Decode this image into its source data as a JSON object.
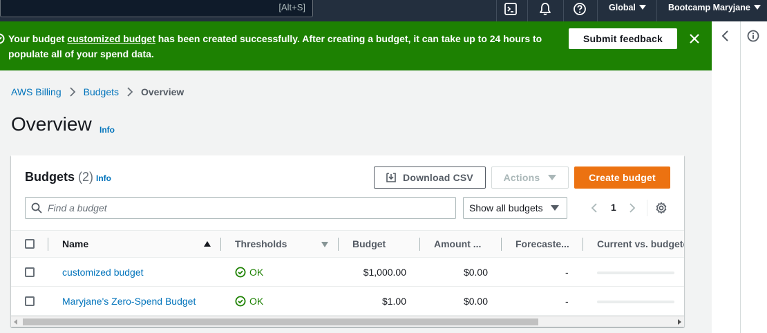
{
  "topnav": {
    "search_shortcut": "[Alt+S]",
    "region": "Global",
    "account": "Bootcamp Maryjane",
    "icons": [
      "cloudshell-icon",
      "bell-icon",
      "help-icon"
    ]
  },
  "flash": {
    "prefix": "Your budget ",
    "link": "customized budget",
    "suffix": " has been created successfully. After creating a budget, it can take up to 24 hours to populate all of your spend data.",
    "feedback_label": "Submit feedback"
  },
  "breadcrumb": {
    "items": [
      "AWS Billing",
      "Budgets"
    ],
    "current": "Overview"
  },
  "page": {
    "title": "Overview",
    "info": "Info"
  },
  "budgets": {
    "title": "Budgets",
    "count": "(2)",
    "info": "Info",
    "download_label": "Download CSV",
    "actions_label": "Actions",
    "create_label": "Create budget",
    "search_placeholder": "Find a budget",
    "filter_value": "Show all budgets",
    "page_number": "1",
    "columns": [
      "Name",
      "Thresholds",
      "Budget",
      "Amount ...",
      "Forecaste...",
      "Current vs. budgeted"
    ],
    "rows": [
      {
        "name": "customized budget",
        "threshold": "OK",
        "budget": "$1,000.00",
        "amount": "$0.00",
        "forecast": "-"
      },
      {
        "name": "Maryjane's Zero-Spend Budget",
        "threshold": "OK",
        "budget": "$1.00",
        "amount": "$0.00",
        "forecast": "-"
      }
    ]
  },
  "colors": {
    "nav_bg": "#232f3e",
    "success_green": "#1d8102",
    "link_blue": "#0073bb",
    "primary_orange": "#ec7211"
  }
}
